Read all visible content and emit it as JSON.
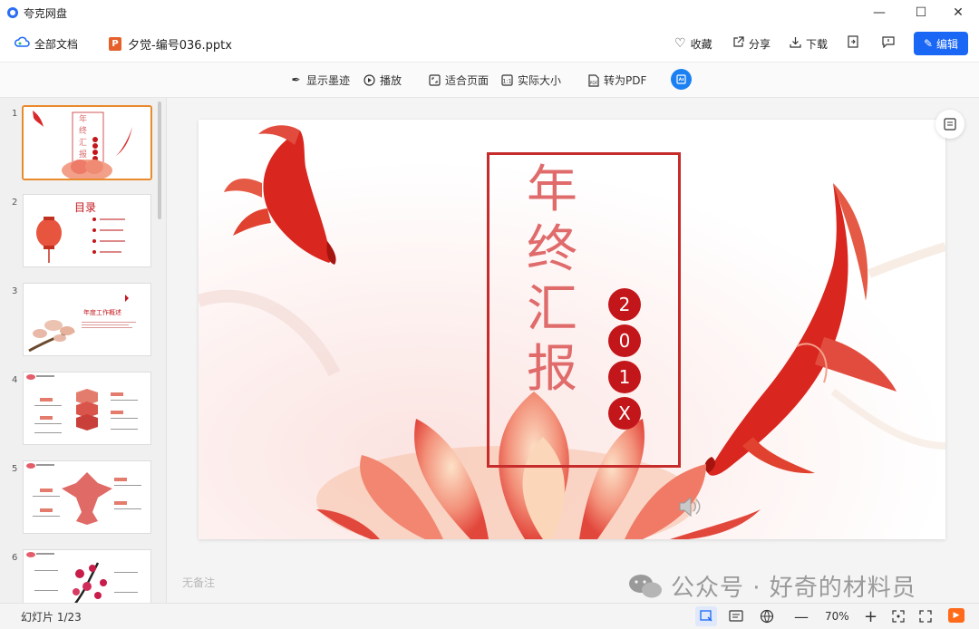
{
  "app": {
    "title": "夸克网盘"
  },
  "window_controls": {
    "minimize": "—",
    "maximize": "☐",
    "close": "✕"
  },
  "header": {
    "all_docs": "全部文档",
    "file_badge": "P",
    "filename": "夕觉-编号036.pptx",
    "favorite": "收藏",
    "share": "分享",
    "download": "下载",
    "edit": "编辑"
  },
  "toolbar": {
    "show_ink": "显示墨迹",
    "play": "播放",
    "fit_page": "适合页面",
    "actual_size": "实际大小",
    "to_pdf": "转为PDF"
  },
  "thumbnails": [
    {
      "num": "1",
      "title": "年终汇报",
      "selected": true
    },
    {
      "num": "2",
      "title": "目录",
      "selected": false
    },
    {
      "num": "3",
      "title": "年度工作概述",
      "selected": false
    },
    {
      "num": "4",
      "title": "",
      "selected": false
    },
    {
      "num": "5",
      "title": "",
      "selected": false
    },
    {
      "num": "6",
      "title": "",
      "selected": false
    }
  ],
  "slide": {
    "title_chars": [
      "年",
      "终",
      "汇",
      "报"
    ],
    "year_digits": [
      "2",
      "0",
      "1",
      "X"
    ]
  },
  "notes": {
    "placeholder": "无备注"
  },
  "watermark": {
    "text": "公众号 · 好奇的材料员"
  },
  "status": {
    "slide_counter": "幻灯片 1/23",
    "zoom": "70%"
  },
  "colors": {
    "accent": "#1a66f5",
    "slide_red": "#c3161b",
    "title_pink": "#e06b6b",
    "selection": "#e98a2c"
  }
}
